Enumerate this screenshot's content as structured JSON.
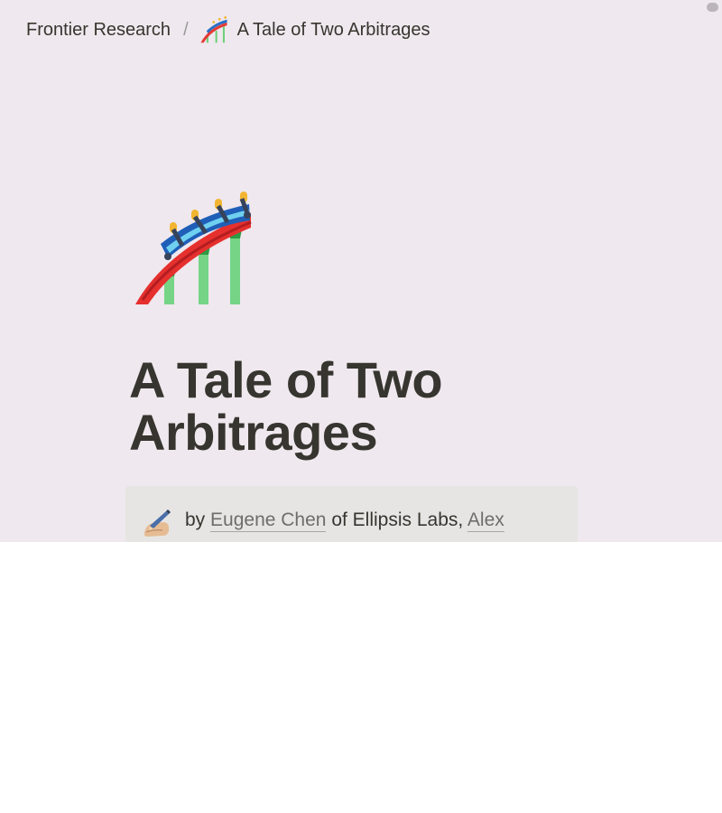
{
  "breadcrumb": {
    "workspace": "Frontier Research",
    "separator": "/",
    "page_icon": "roller-coaster-icon",
    "page": "A Tale of Two Arbitrages"
  },
  "page": {
    "icon": "roller-coaster-icon",
    "title": "A Tale of Two Arbitrages"
  },
  "callout": {
    "icon": "writing-hand-icon",
    "by": "by",
    "author1": "Eugene Chen",
    "of_org": "of Ellipsis Labs,",
    "author2": "Alex"
  },
  "colors": {
    "page_bg": "#efe8ee",
    "text": "#37352f",
    "callout_bg": "#e6e5e3",
    "link": "#6f6d69"
  }
}
